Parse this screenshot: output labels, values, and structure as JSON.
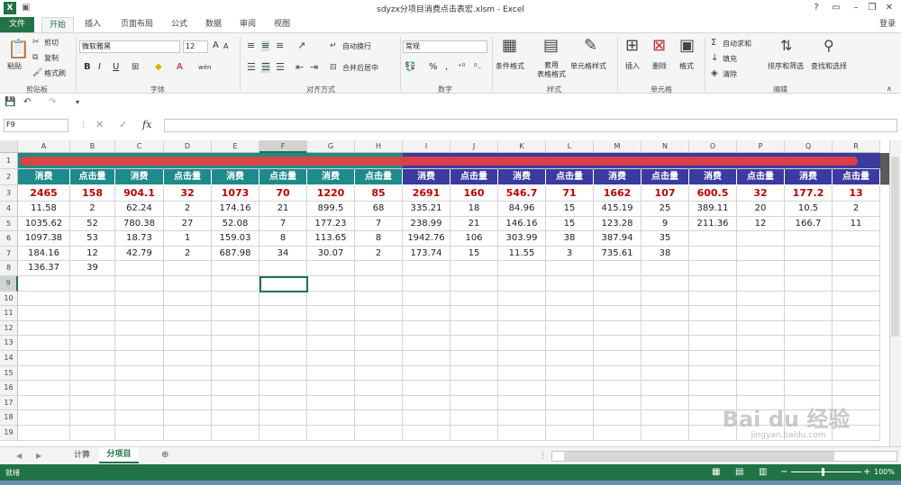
{
  "app": {
    "title": "sdyzx分项目消费点击表宏.xlsm - Excel",
    "login": "登录",
    "logo": "X"
  },
  "tabs": [
    "文件",
    "开始",
    "插入",
    "页面布局",
    "公式",
    "数据",
    "审阅",
    "视图"
  ],
  "ribbon": {
    "clipboard": {
      "paste": "粘贴",
      "cut": "剪切",
      "copy": "复制",
      "format_painter": "格式刷",
      "label": "剪贴板"
    },
    "font": {
      "name": "微软雅黑",
      "size": "12",
      "label": "字体",
      "bold": "B",
      "italic": "I",
      "underline": "U",
      "grow": "A",
      "shrink": "A",
      "phonetic": "wén"
    },
    "alignment": {
      "wrap": "自动换行",
      "merge": "合并后居中",
      "label": "对齐方式"
    },
    "number": {
      "format": "常规",
      "pct": "%",
      "comma": ",",
      "label": "数字"
    },
    "styles": {
      "conditional": "条件格式",
      "table": "套用\n表格格式",
      "cell": "单元格样式",
      "label": "样式"
    },
    "cells": {
      "insert": "插入",
      "delete": "删除",
      "format": "格式",
      "label": "单元格"
    },
    "editing": {
      "autosum": "自动求和",
      "fill": "填充",
      "clear": "清除",
      "sort": "排序和筛选",
      "find": "查找和选择",
      "label": "编辑"
    }
  },
  "name_box": "F9",
  "formula_icon": "fx",
  "columns": [
    "A",
    "B",
    "C",
    "D",
    "E",
    "F",
    "G",
    "H",
    "I",
    "J",
    "K",
    "L",
    "M",
    "N",
    "O",
    "P",
    "Q",
    "R"
  ],
  "row_numbers": [
    "1",
    "2",
    "3",
    "4",
    "5",
    "6",
    "7",
    "8",
    "9",
    "10",
    "11",
    "12",
    "13",
    "14",
    "15",
    "16",
    "17",
    "18",
    "19"
  ],
  "header_row": [
    "消费",
    "点击量",
    "消费",
    "点击量",
    "消费",
    "点击量",
    "消费",
    "点击量",
    "消费",
    "点击量",
    "消费",
    "点击量",
    "消费",
    "点击量",
    "消费",
    "点击量",
    "消费",
    "点击量"
  ],
  "total_row": [
    "2465",
    "158",
    "904.1",
    "32",
    "1073",
    "70",
    "1220",
    "85",
    "2691",
    "160",
    "546.7",
    "71",
    "1662",
    "107",
    "600.5",
    "32",
    "177.2",
    "13"
  ],
  "data_rows": [
    [
      "11.58",
      "2",
      "62.24",
      "2",
      "174.16",
      "21",
      "899.5",
      "68",
      "335.21",
      "18",
      "84.96",
      "15",
      "415.19",
      "25",
      "389.11",
      "20",
      "10.5",
      "2"
    ],
    [
      "1035.62",
      "52",
      "780.38",
      "27",
      "52.08",
      "7",
      "177.23",
      "7",
      "238.99",
      "21",
      "146.16",
      "15",
      "123.28",
      "9",
      "211.36",
      "12",
      "166.7",
      "11"
    ],
    [
      "1097.38",
      "53",
      "18.73",
      "1",
      "159.03",
      "8",
      "113.65",
      "8",
      "1942.76",
      "106",
      "303.99",
      "38",
      "387.94",
      "35",
      "",
      "",
      "",
      ""
    ],
    [
      "184.16",
      "12",
      "42.79",
      "2",
      "687.98",
      "34",
      "30.07",
      "2",
      "173.74",
      "15",
      "11.55",
      "3",
      "735.61",
      "38",
      "",
      "",
      "",
      ""
    ],
    [
      "136.37",
      "39",
      "",
      "",
      "",
      "",
      "",
      "",
      "",
      "",
      "",
      "",
      "",
      "",
      "",
      "",
      "",
      ""
    ]
  ],
  "sheets": [
    "计算",
    "分项目"
  ],
  "active_sheet": "分项目",
  "status": {
    "ready": "就绪",
    "zoom": "100%"
  },
  "watermark": {
    "brand": "Bai du 经验",
    "url": "jingyan.baidu.com"
  },
  "colors": {
    "excel_green": "#217346",
    "teal": "#1f8a8a",
    "navy": "#3a3aa0",
    "red_total": "#c00000",
    "red_stroke": "#e84040"
  }
}
